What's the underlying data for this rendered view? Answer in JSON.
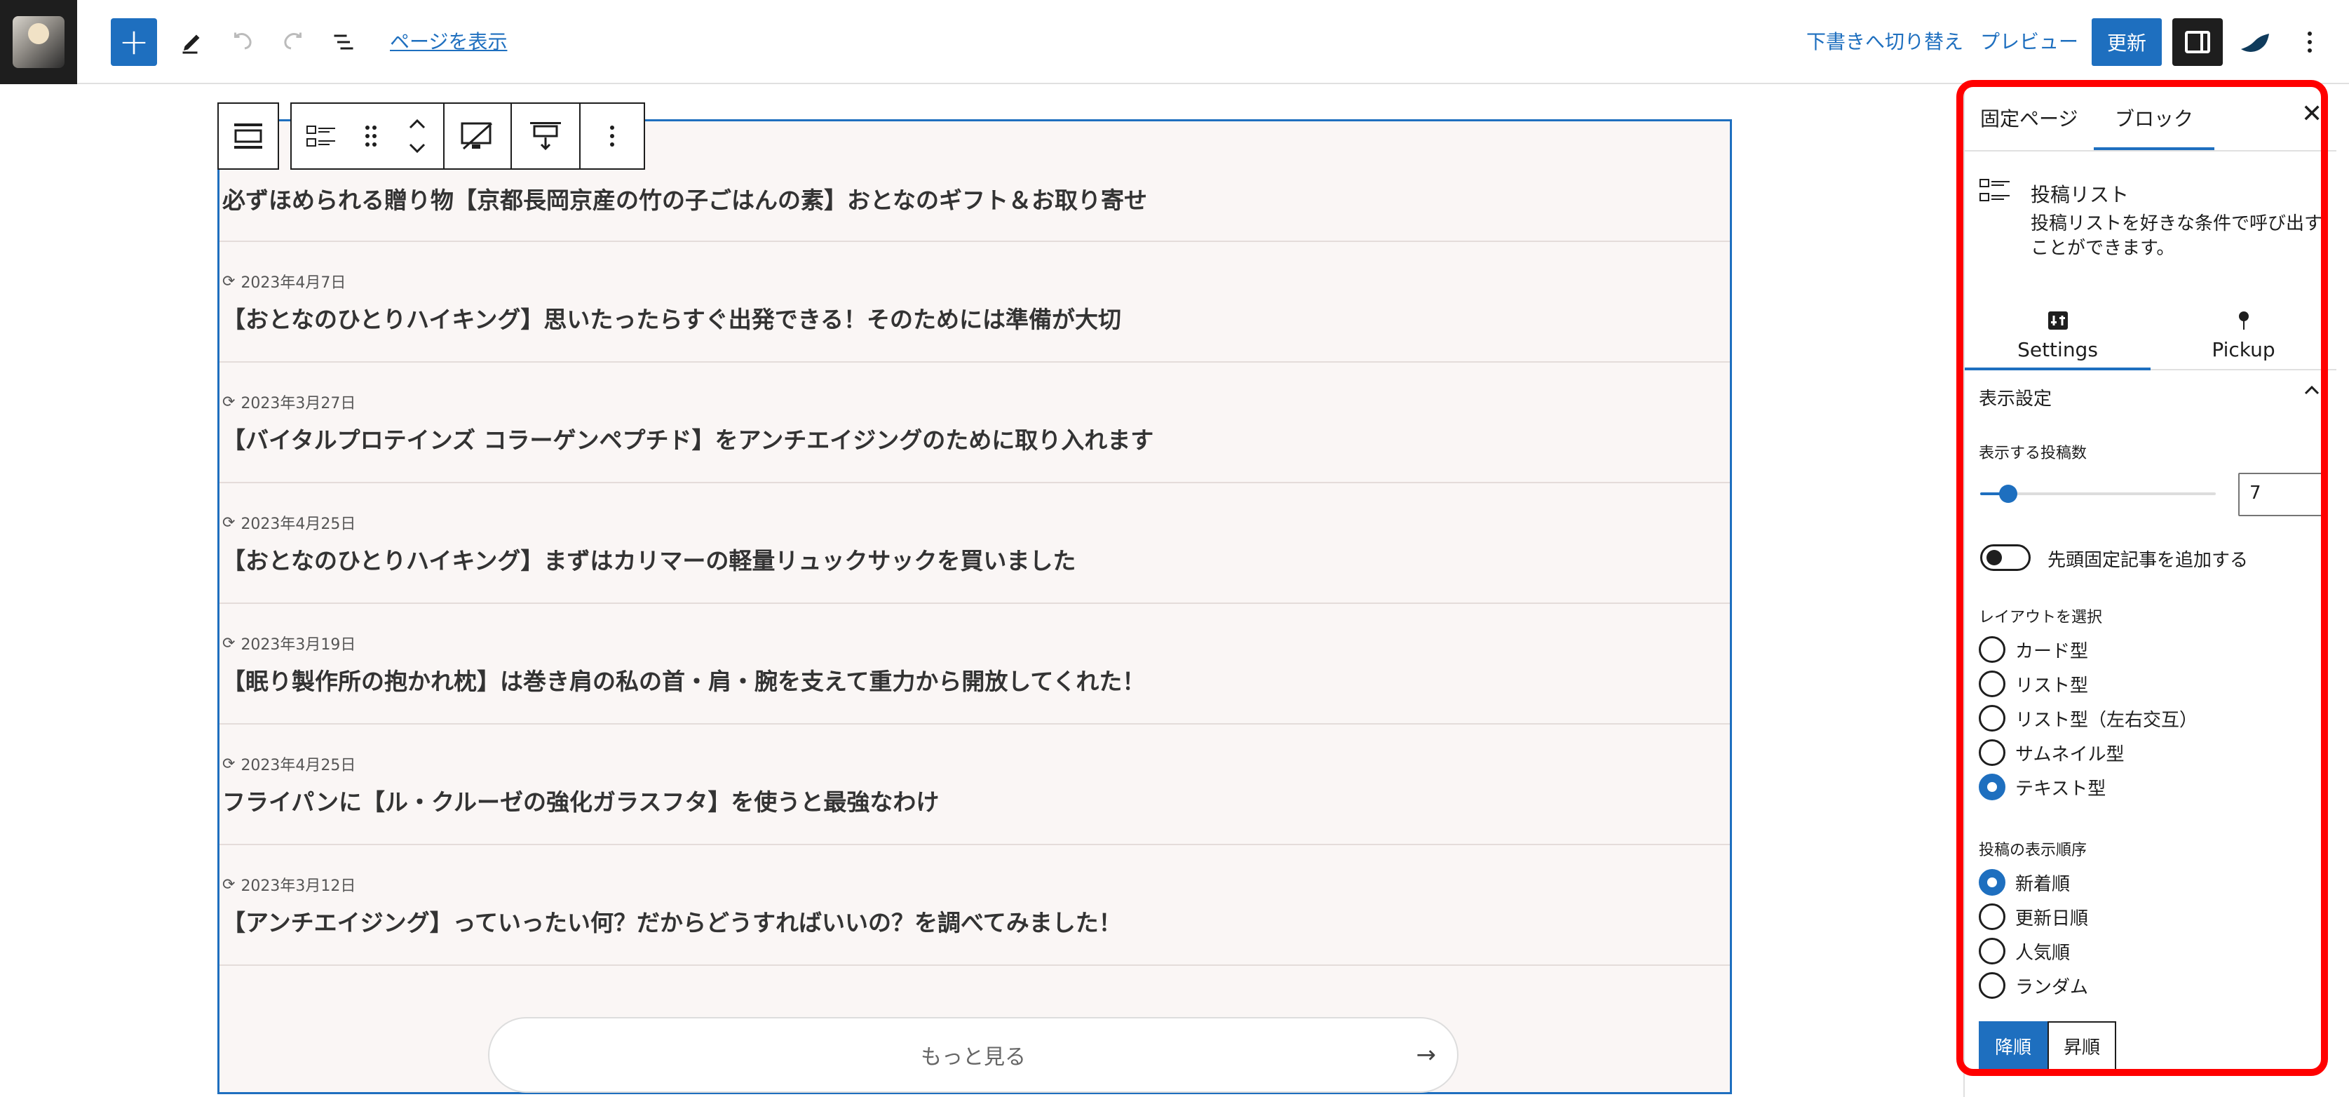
{
  "toolbar": {
    "add_label": "+",
    "view_page_label": "ページを表示",
    "switch_draft_label": "下書きへ切り替え",
    "preview_label": "プレビュー",
    "update_label": "更新"
  },
  "posts": [
    {
      "date": "",
      "title": "必ずほめられる贈り物【京都長岡京産の竹の子ごはんの素】おとなのギフト＆お取り寄せ"
    },
    {
      "date": "2023年4月7日",
      "title": "【おとなのひとりハイキング】思いたったらすぐ出発できる！そのためには準備が大切"
    },
    {
      "date": "2023年3月27日",
      "title": "【バイタルプロテインズ コラーゲンペプチド】をアンチエイジングのために取り入れます"
    },
    {
      "date": "2023年4月25日",
      "title": "【おとなのひとりハイキング】まずはカリマーの軽量リュックサックを買いました"
    },
    {
      "date": "2023年3月19日",
      "title": "【眠り製作所の抱かれ枕】は巻き肩の私の首・肩・腕を支えて重力から開放してくれた！"
    },
    {
      "date": "2023年4月25日",
      "title": "フライパンに【ル・クルーゼの強化ガラスフタ】を使うと最強なわけ"
    },
    {
      "date": "2023年3月12日",
      "title": "【アンチエイジング】っていったい何？だからどうすればいいの？を調べてみました！"
    }
  ],
  "more_button": {
    "label": "もっと見る",
    "arrow": "→"
  },
  "sidebar": {
    "tab_page": "固定ページ",
    "tab_block": "ブロック",
    "block_name": "投稿リスト",
    "block_description": "投稿リストを好きな条件で呼び出すことができます。",
    "subtab_settings": "Settings",
    "subtab_pickup": "Pickup",
    "panel_title": "表示設定",
    "post_count_label": "表示する投稿数",
    "post_count_value": "7",
    "post_count_slider_fraction": 0.12,
    "sticky_toggle_label": "先頭固定記事を追加する",
    "sticky_toggle_on": false,
    "layout_label": "レイアウトを選択",
    "layouts": [
      {
        "label": "カード型",
        "checked": false
      },
      {
        "label": "リスト型",
        "checked": false
      },
      {
        "label": "リスト型（左右交互）",
        "checked": false
      },
      {
        "label": "サムネイル型",
        "checked": false
      },
      {
        "label": "テキスト型",
        "checked": true
      }
    ],
    "order_label": "投稿の表示順序",
    "orders": [
      {
        "label": "新着順",
        "checked": true
      },
      {
        "label": "更新日順",
        "checked": false
      },
      {
        "label": "人気順",
        "checked": false
      },
      {
        "label": "ランダム",
        "checked": false
      }
    ],
    "sort_desc_label": "降順",
    "sort_asc_label": "昇順",
    "sort_active": "desc"
  },
  "colors": {
    "accent": "#1e6fbf",
    "highlight": "#ff0000",
    "block_bg": "#faf6f5"
  }
}
